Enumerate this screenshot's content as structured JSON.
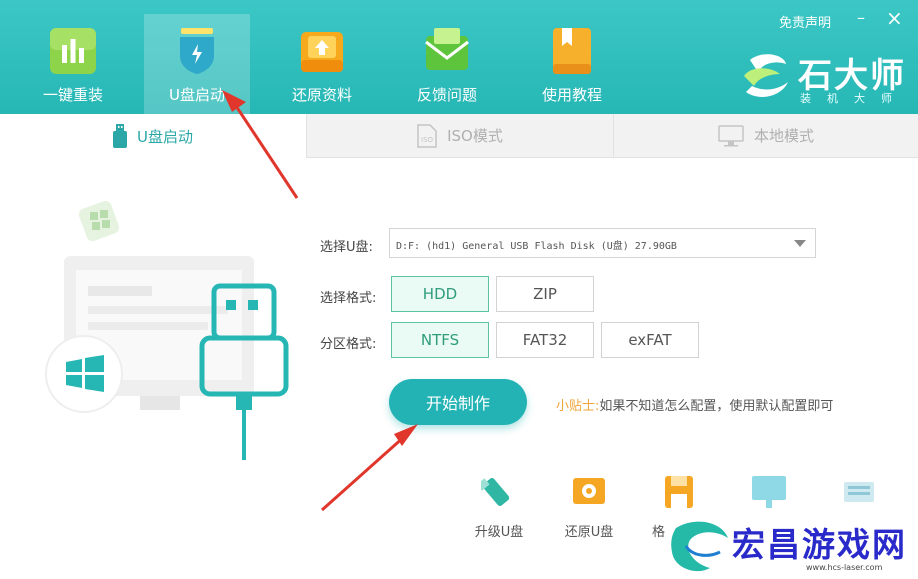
{
  "nav": {
    "items": [
      {
        "label": "一键重装",
        "icon": "bar-chart-icon"
      },
      {
        "label": "U盘启动",
        "icon": "usb-shield-icon"
      },
      {
        "label": "还原资料",
        "icon": "upload-box-icon"
      },
      {
        "label": "反馈问题",
        "icon": "mail-envelope-icon"
      },
      {
        "label": "使用教程",
        "icon": "book-icon"
      }
    ],
    "active_index": 1
  },
  "window": {
    "disclaimer": "免责声明",
    "minimize": "–",
    "close": "×"
  },
  "brand": {
    "name": "石大师",
    "subtitle": "装机大师"
  },
  "tabs": [
    {
      "label": "U盘启动",
      "icon": "usb-drive-icon"
    },
    {
      "label": "ISO模式",
      "icon": "iso-file-icon"
    },
    {
      "label": "本地模式",
      "icon": "monitor-icon"
    }
  ],
  "form": {
    "usb_label": "选择U盘:",
    "usb_value": "D:F: (hd1) General USB Flash Disk  (U盘) 27.90GB",
    "format_label": "选择格式:",
    "format_options": [
      "HDD",
      "ZIP"
    ],
    "format_selected": "HDD",
    "partition_label": "分区格式:",
    "partition_options": [
      "NTFS",
      "FAT32",
      "exFAT"
    ],
    "partition_selected": "NTFS",
    "start_button": "开始制作",
    "tip_key": "小贴士:",
    "tip_text": "如果不知道怎么配置，使用默认配置即可"
  },
  "tools": [
    {
      "label": "升级U盘",
      "icon": "usb-upgrade-icon"
    },
    {
      "label": "还原U盘",
      "icon": "usb-restore-icon"
    },
    {
      "label": "格",
      "icon": "floppy-disk-icon"
    }
  ],
  "watermark": {
    "text": "宏昌游戏网",
    "url": "www.hcs-laser.com"
  },
  "colors": {
    "primary": "#26b7b5",
    "selected_border": "#5cc3a2",
    "tip": "#f0a43a",
    "arrow": "#e0362c"
  }
}
